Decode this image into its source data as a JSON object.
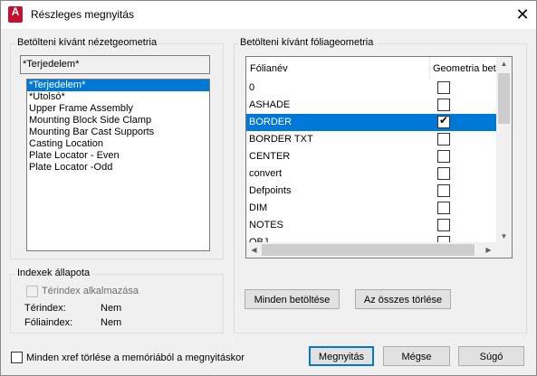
{
  "window": {
    "title": "Részleges megnyitás",
    "icon_letter": "A"
  },
  "view_group": {
    "label": "Betölteni kívánt nézetgeometria",
    "selected_value": "*Terjedelem*",
    "items": [
      "*Terjedelem*",
      "*Utolsó*",
      "Upper Frame Assembly",
      "Mounting Block Side Clamp",
      "Mounting Bar Cast Supports",
      "Casting Location",
      "Plate Locator - Even",
      "Plate Locator -Odd"
    ],
    "selected_index": 0
  },
  "index_group": {
    "label": "Indexek állapota",
    "spatial_checkbox_label": "Térindex alkalmazása",
    "spatial_label": "Térindex:",
    "spatial_value": "Nem",
    "layer_label": "Fóliaindex:",
    "layer_value": "Nem"
  },
  "layer_group": {
    "label": "Betölteni kívánt fóliageometria",
    "col_name": "Fólianév",
    "col_geometry": "Geometria bet",
    "rows": [
      {
        "name": "0",
        "checked": false,
        "selected": false
      },
      {
        "name": "ASHADE",
        "checked": false,
        "selected": false
      },
      {
        "name": "BORDER",
        "checked": true,
        "selected": true
      },
      {
        "name": "BORDER TXT",
        "checked": false,
        "selected": false
      },
      {
        "name": "CENTER",
        "checked": false,
        "selected": false
      },
      {
        "name": "convert",
        "checked": false,
        "selected": false
      },
      {
        "name": "Defpoints",
        "checked": false,
        "selected": false
      },
      {
        "name": "DIM",
        "checked": false,
        "selected": false
      },
      {
        "name": "NOTES",
        "checked": false,
        "selected": false
      },
      {
        "name": "OBJ",
        "checked": false,
        "selected": false
      }
    ],
    "load_all_button": "Minden betöltése",
    "clear_all_button": "Az összes törlése"
  },
  "footer": {
    "unload_xref_label": "Minden xref törlése a memóriából a megnyitáskor",
    "open_button": "Megnyitás",
    "cancel_button": "Mégse",
    "help_button": "Súgó"
  }
}
